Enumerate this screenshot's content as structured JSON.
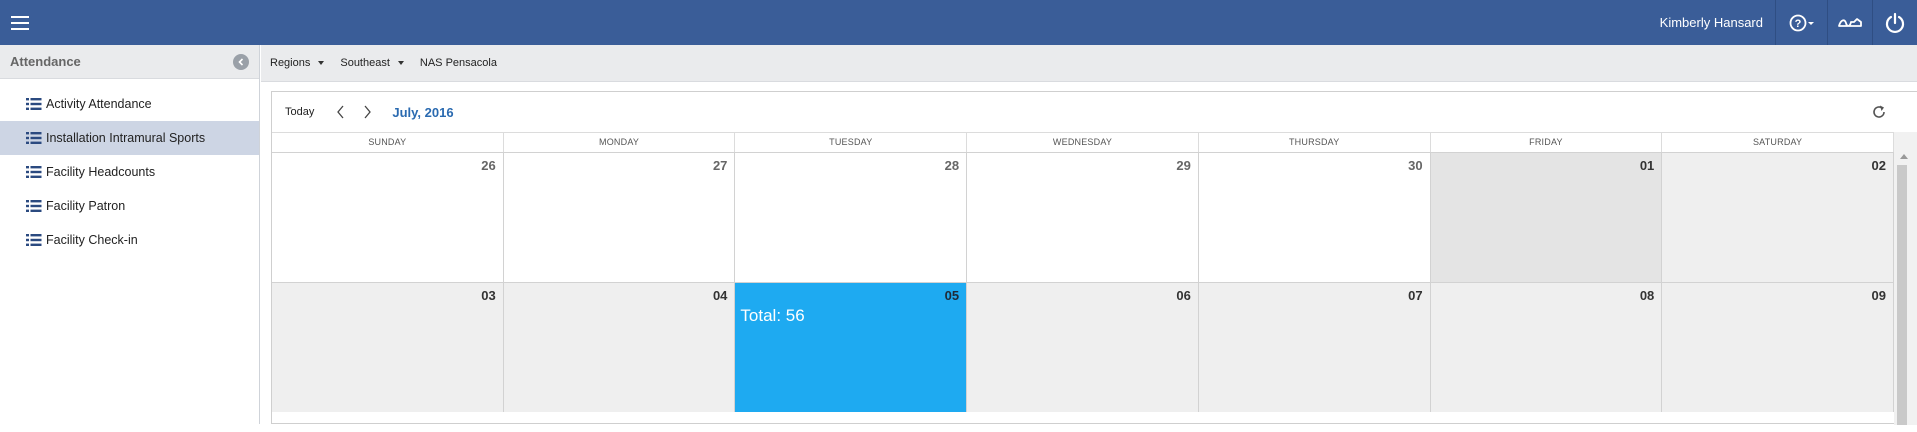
{
  "header": {
    "user_name": "Kimberly Hansard",
    "icons": [
      "menu-icon",
      "help-icon",
      "signature-icon",
      "power-icon"
    ],
    "bg_color": "#3a5d98"
  },
  "sidebar": {
    "title": "Attendance",
    "items": [
      {
        "label": "Activity Attendance",
        "active": false
      },
      {
        "label": "Installation Intramural Sports",
        "active": true
      },
      {
        "label": "Facility Headcounts",
        "active": false
      },
      {
        "label": "Facility Patron",
        "active": false
      },
      {
        "label": "Facility Check-in",
        "active": false
      }
    ]
  },
  "breadcrumb": {
    "items": [
      {
        "label": "Regions",
        "dropdown": true
      },
      {
        "label": "Southeast",
        "dropdown": true
      },
      {
        "label": "NAS Pensacola",
        "dropdown": false
      }
    ]
  },
  "calendar": {
    "today_label": "Today",
    "month_title": "July, 2016",
    "day_headers": [
      "SUNDAY",
      "MONDAY",
      "TUESDAY",
      "WEDNESDAY",
      "THURSDAY",
      "FRIDAY",
      "SATURDAY"
    ],
    "weeks": [
      [
        {
          "day": "26",
          "style": "plain"
        },
        {
          "day": "27",
          "style": "plain"
        },
        {
          "day": "28",
          "style": "plain"
        },
        {
          "day": "29",
          "style": "plain"
        },
        {
          "day": "30",
          "style": "plain"
        },
        {
          "day": "01",
          "style": "past-gray"
        },
        {
          "day": "02",
          "style": "gray"
        }
      ],
      [
        {
          "day": "03",
          "style": "gray"
        },
        {
          "day": "04",
          "style": "gray"
        },
        {
          "day": "05",
          "style": "highlight",
          "total": "Total: 56"
        },
        {
          "day": "06",
          "style": "gray"
        },
        {
          "day": "07",
          "style": "gray"
        },
        {
          "day": "08",
          "style": "gray"
        },
        {
          "day": "09",
          "style": "gray"
        }
      ]
    ],
    "highlight_color": "#1eaaf1"
  }
}
